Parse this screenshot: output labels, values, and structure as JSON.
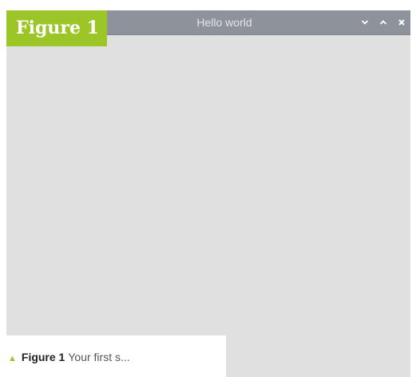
{
  "window": {
    "title": "Hello world",
    "controls": {
      "minimize": "chevron-down-icon",
      "maximize": "chevron-up-icon",
      "close": "close-icon"
    }
  },
  "figure": {
    "label": "Figure 1"
  },
  "caption": {
    "arrow": "▲",
    "figure_ref": "Figure 1",
    "text": "Your first s..."
  },
  "colors": {
    "titlebar": "#8e939b",
    "body": "#e1e0e1",
    "accent": "#9cc628"
  }
}
